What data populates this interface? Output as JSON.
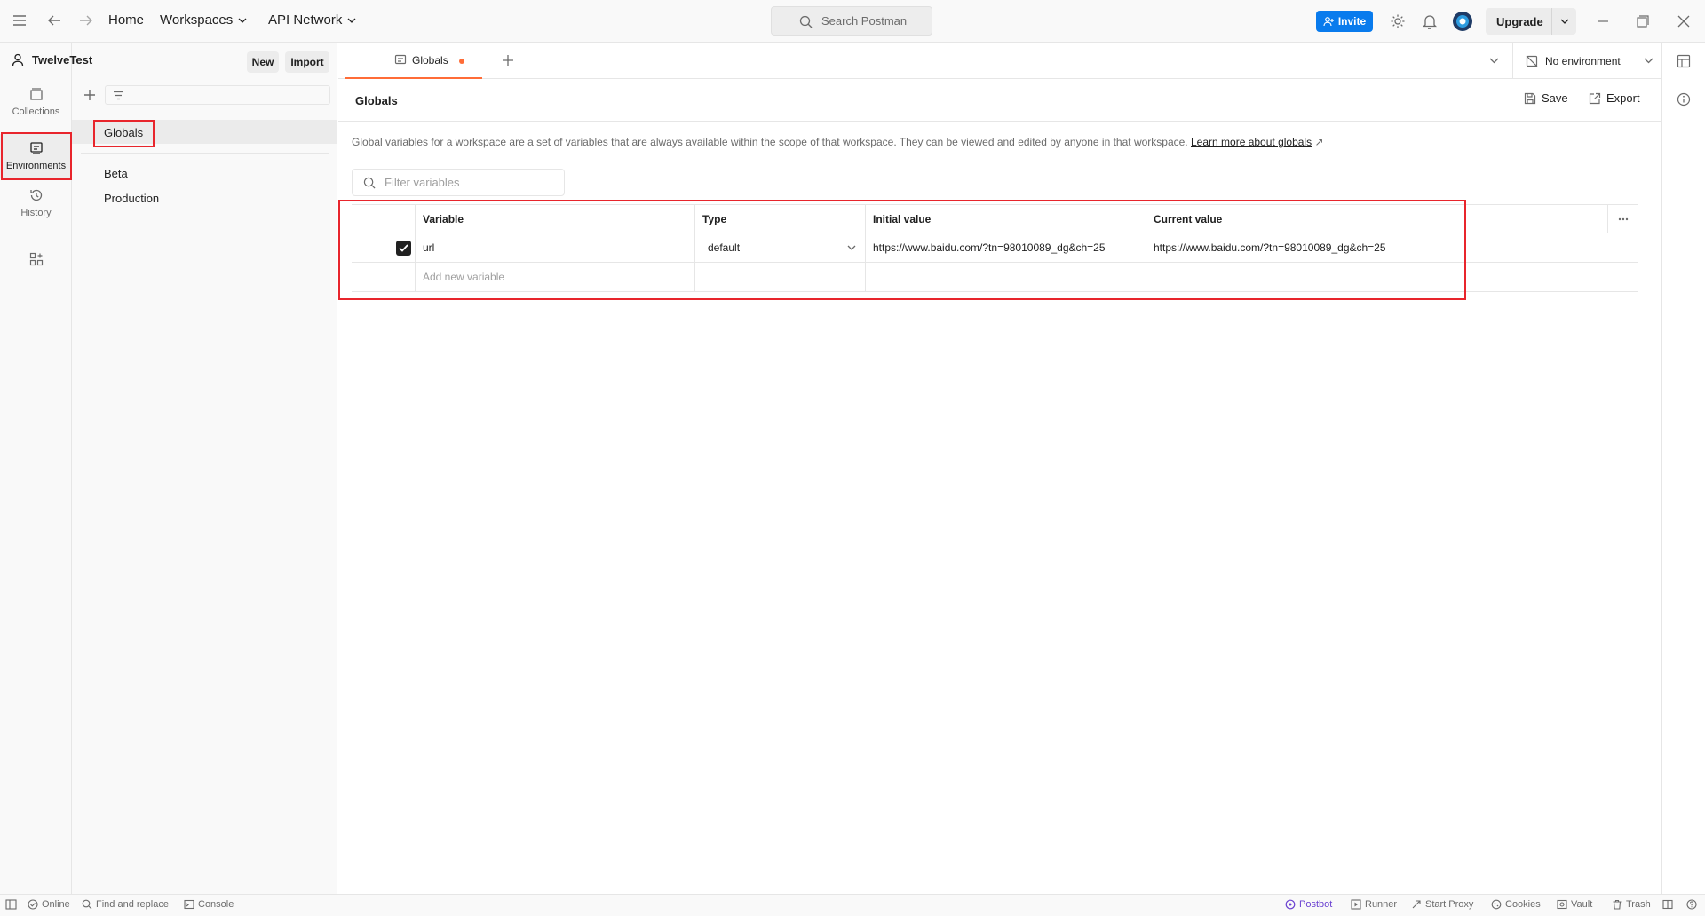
{
  "topbar": {
    "home": "Home",
    "workspaces": "Workspaces",
    "api_network": "API Network",
    "search_placeholder": "Search Postman",
    "invite": "Invite",
    "upgrade": "Upgrade"
  },
  "rail": {
    "collections": "Collections",
    "environments": "Environments",
    "history": "History"
  },
  "sidebar": {
    "workspace_name": "TwelveTest",
    "new_label": "New",
    "import_label": "Import",
    "items": [
      {
        "label": "Globals"
      },
      {
        "label": "Beta"
      },
      {
        "label": "Production"
      }
    ]
  },
  "tabs": {
    "active_tab": "Globals",
    "environment": "No environment"
  },
  "main": {
    "title": "Globals",
    "save_label": "Save",
    "export_label": "Export",
    "description": "Global variables for a workspace are a set of variables that are always available within the scope of that workspace. They can be viewed and edited by anyone in that workspace.",
    "learn_more": "Learn more about globals",
    "filter_placeholder": "Filter variables"
  },
  "table": {
    "columns": [
      "Variable",
      "Type",
      "Initial value",
      "Current value"
    ],
    "rows": [
      {
        "checked": true,
        "variable": "url",
        "type": "default",
        "initial": "https://www.baidu.com/?tn=98010089_dg&ch=25",
        "current": "https://www.baidu.com/?tn=98010089_dg&ch=25"
      }
    ],
    "add_placeholder": "Add new variable"
  },
  "statusbar": {
    "online": "Online",
    "find_replace": "Find and replace",
    "console": "Console",
    "postbot": "Postbot",
    "runner": "Runner",
    "start_proxy": "Start Proxy",
    "cookies": "Cookies",
    "vault": "Vault",
    "trash": "Trash"
  },
  "colors": {
    "accent_orange": "#ff6c37",
    "invite_blue": "#097bed",
    "highlight_red": "#e8252c",
    "postbot_purple": "#6b42d1"
  }
}
